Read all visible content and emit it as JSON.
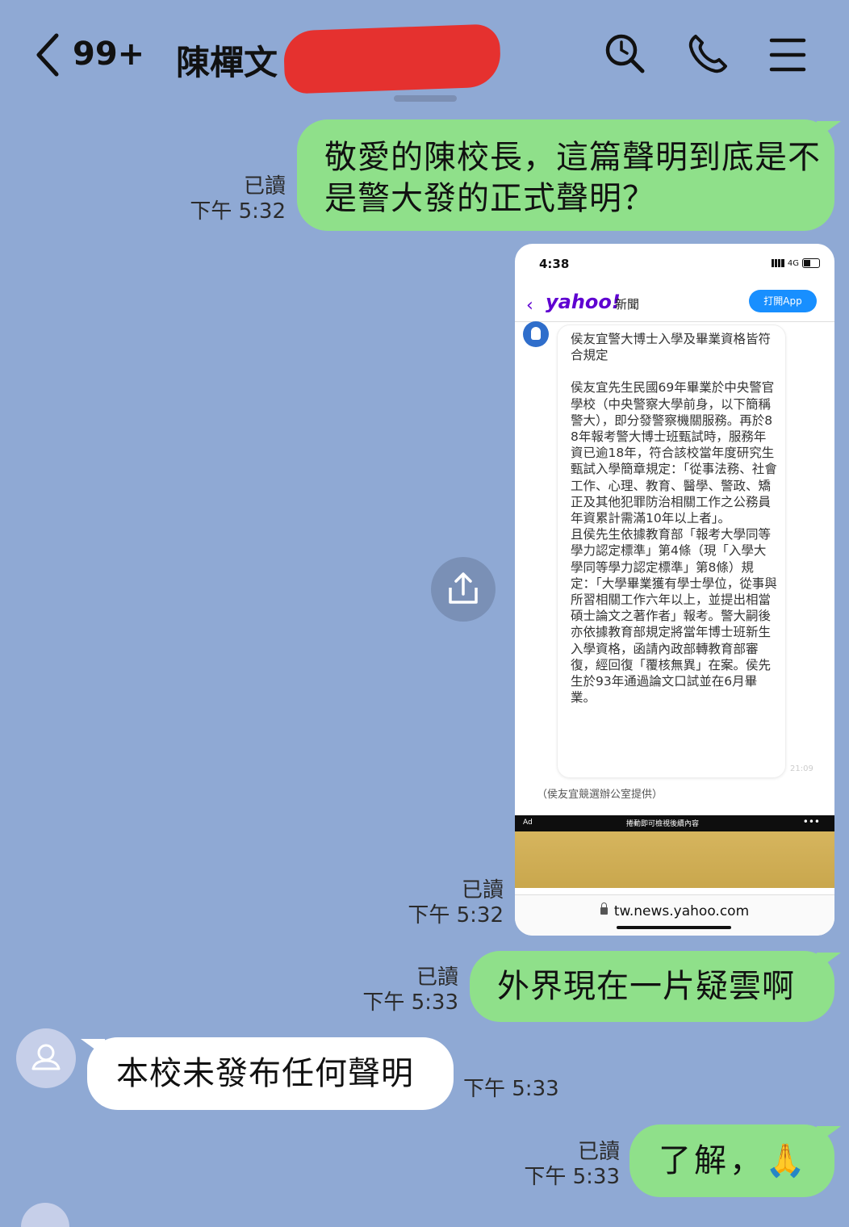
{
  "header": {
    "back_label": "<",
    "unread_count": "99+",
    "contact_name": "陳樿文",
    "icons": [
      "search-icon",
      "phone-icon",
      "menu-icon"
    ]
  },
  "messages": [
    {
      "direction": "out",
      "text": "敬愛的陳校長，這篇聲明到底是不是警大發的正式聲明？",
      "read": "已讀",
      "time": "下午 5:32"
    },
    {
      "direction": "out",
      "type": "image",
      "read": "已讀",
      "time": "下午 5:32"
    },
    {
      "direction": "out",
      "text": "外界現在一片疑雲啊",
      "read": "已讀",
      "time": "下午 5:33"
    },
    {
      "direction": "in",
      "text": "本校未發布任何聲明",
      "time": "下午 5:33"
    },
    {
      "direction": "out",
      "text": "了解，🙏",
      "read": "已讀",
      "time": "下午 5:33"
    }
  ],
  "screenshot": {
    "time": "4:38",
    "network": "4G",
    "logo": "yahoo!",
    "section": "新聞",
    "open_app": "打開App",
    "paragraph_title": "侯友宜警大博士入學及畢業資格皆符合規定",
    "paragraph_1": "侯友宜先生民國69年畢業於中央警官學校（中央警察大學前身，以下簡稱警大），即分發警察機關服務。再於88年報考警大博士班甄試時，服務年資已逾18年，符合該校當年度研究生甄試入學簡章規定：「從事法務、社會工作、心理、教育、醫學、警政、矯正及其他犯罪防治相關工作之公務員年資累計需滿10年以上者」。",
    "paragraph_2": "且侯先生依據教育部「報考大學同等學力認定標準」第4條（現「入學大學同等學力認定標準」第8條）規定：「大學畢業獲有學士學位，從事與所習相關工作六年以上，並提出相當碩士論文之著作者」報考。警大嗣後亦依據教育部規定將當年博士班新生入學資格，函請內政部轉教育部審復，經回復「覆核無異」在案。侯先生於93年通過論文口試並在6月畢業。",
    "bubble_time": "21:09",
    "caption": "（侯友宜競選辦公室提供）",
    "ad_label": "Ad",
    "ad_text": "捲動即可檢視後續內容",
    "ad_more": "•••",
    "url": "tw.news.yahoo.com"
  },
  "colors": {
    "background": "#8fa9d4",
    "bubble_out": "#8fe08a",
    "bubble_in": "#ffffff",
    "redaction": "#e5312f",
    "yahoo_purple": "#5f01d1",
    "open_app_blue": "#188fff"
  }
}
